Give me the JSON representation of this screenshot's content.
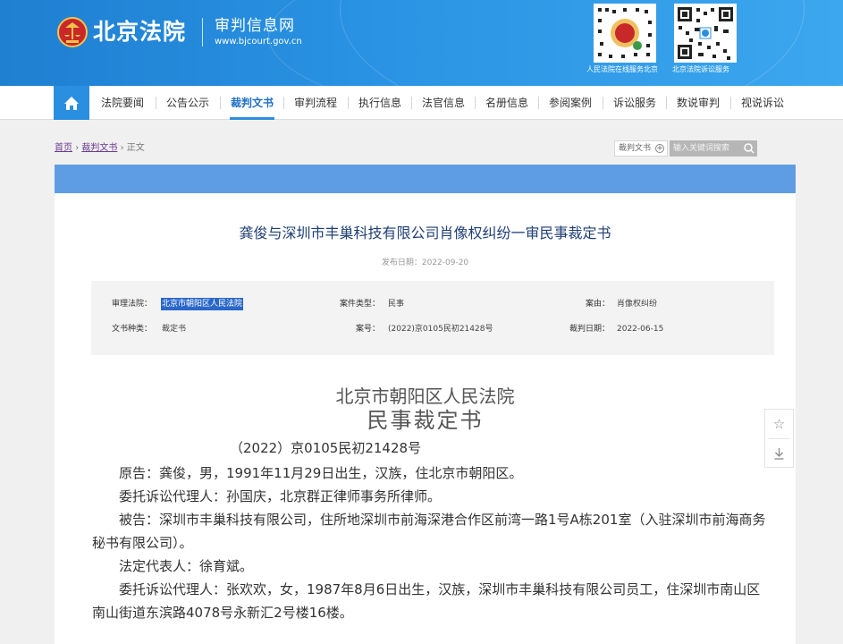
{
  "header": {
    "logo_text": "北京法院",
    "site_title": "审判信息网",
    "site_url": "www.bjcourt.gov.cn",
    "qr_codes": [
      {
        "caption": "人民法院在线服务北京"
      },
      {
        "caption": "北京法院诉讼服务"
      }
    ],
    "brand_color": "#2a8fe0"
  },
  "nav": {
    "home_icon": "home-icon",
    "items": [
      {
        "label": "法院要闻"
      },
      {
        "label": "公告公示"
      },
      {
        "label": "裁判文书"
      },
      {
        "label": "审判流程"
      },
      {
        "label": "执行信息"
      },
      {
        "label": "法官信息"
      },
      {
        "label": "名册信息"
      },
      {
        "label": "参阅案例"
      },
      {
        "label": "诉讼服务"
      },
      {
        "label": "数说审判"
      },
      {
        "label": "视说诉讼"
      }
    ],
    "active_index": 2
  },
  "breadcrumb": {
    "home": "首页",
    "sep": "›",
    "section": "裁判文书",
    "current": "正文"
  },
  "search": {
    "category": "裁判文书",
    "placeholder": "输入关键词搜索"
  },
  "document": {
    "title": "龚俊与深圳市丰巢科技有限公司肖像权纠纷一审民事裁定书",
    "publish_date": "发布日期：2022-09-20",
    "info": {
      "court_label": "审理法院：",
      "court_value": "北京市朝阳区人民法院",
      "case_type_label": "案件类型：",
      "case_type_value": "民事",
      "cause_label": "案由：",
      "cause_value": "肖像权纠纷",
      "doc_kind_label": "文书种类：",
      "doc_kind_value": "裁定书",
      "case_no_label": "案号：",
      "case_no_value": "(2022)京0105民初21428号",
      "judge_date_label": "裁判日期：",
      "judge_date_value": "2022-06-15"
    },
    "court_name": "北京市朝阳区人民法院",
    "doc_type": "民事裁定书",
    "case_number": "（2022）京0105民初21428号",
    "paragraphs": [
      "原告：龚俊，男，1991年11月29日出生，汉族，住北京市朝阳区。",
      "委托诉讼代理人：孙国庆，北京群正律师事务所律师。",
      "被告：深圳市丰巢科技有限公司，住所地深圳市前海深港合作区前湾一路1号A栋201室（入驻深圳市前海商务秘书有限公司）。",
      "法定代表人：徐育斌。",
      "委托诉讼代理人：张欢欢，女，1987年8月6日出生，汉族，深圳市丰巢科技有限公司员工，住深圳市南山区南山街道东滨路4078号永新汇2号楼16楼。"
    ]
  },
  "tools": {
    "favorite_icon": "star-icon",
    "download_icon": "download-icon"
  }
}
